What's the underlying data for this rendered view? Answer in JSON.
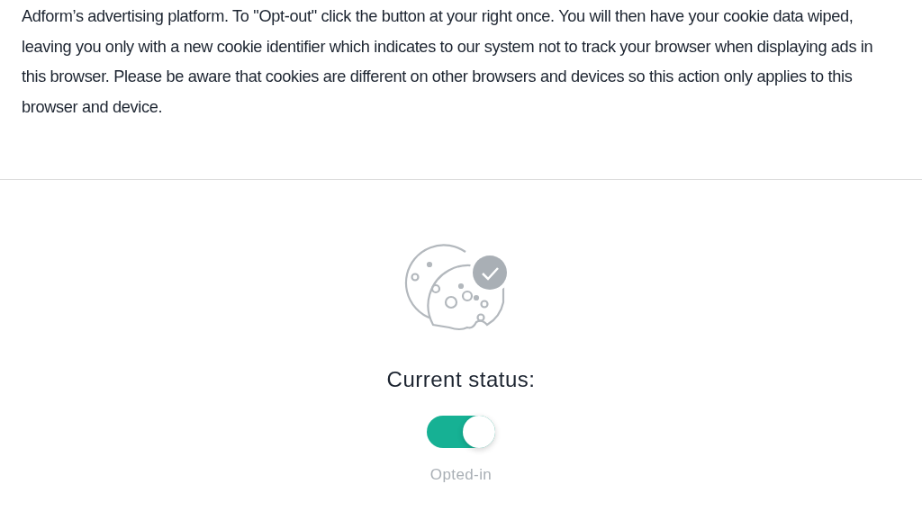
{
  "intro": "Adform’s advertising platform. To \"Opt-out\" click the button at your right once. You will then have your cookie data wiped, leaving you only with a new cookie identifier which indicates to our system not to track your browser when displaying ads in this browser. Please be aware that cookies are different on other browsers and devices so this action only applies to this browser and device.",
  "status": {
    "heading": "Current status:",
    "on": true,
    "label": "Opted-in"
  }
}
